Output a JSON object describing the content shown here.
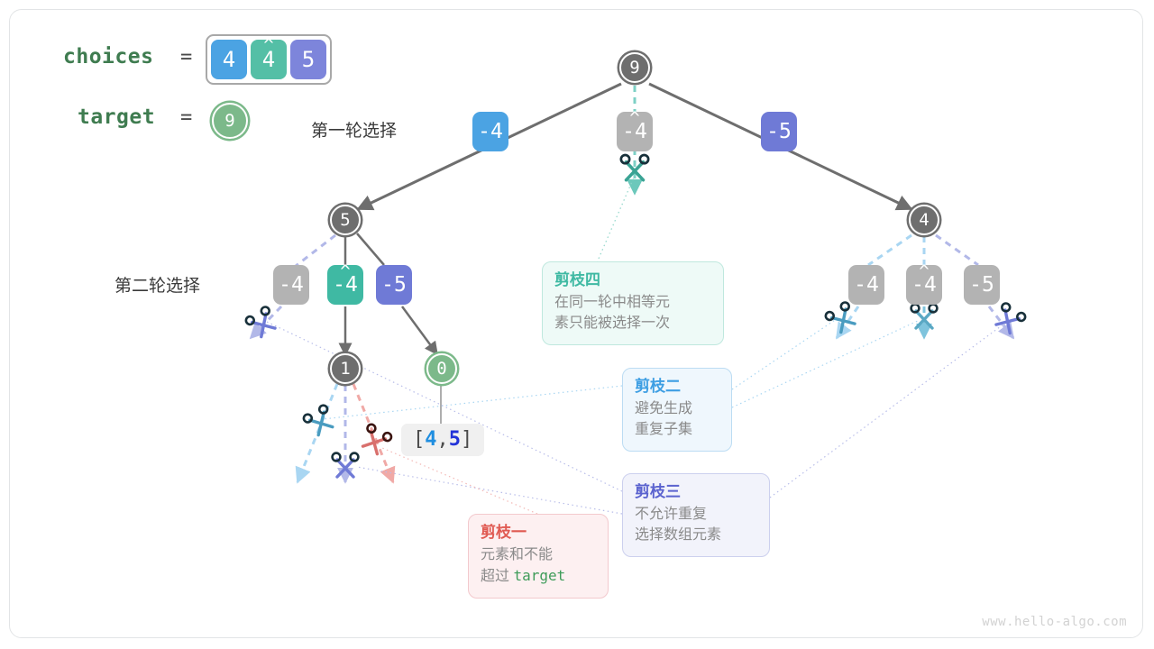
{
  "header": {
    "choices_label": "choices",
    "equals": "=",
    "choices": [
      {
        "value": "4",
        "hat": false,
        "color": "#4ba3e3"
      },
      {
        "value": "4",
        "hat": true,
        "color": "#54bfa6"
      },
      {
        "value": "5",
        "hat": false,
        "color": "#7d85db"
      }
    ],
    "target_label": "target",
    "target_value": "9"
  },
  "round_labels": {
    "first": "第一轮选择",
    "second": "第二轮选择"
  },
  "nodes": {
    "root": "9",
    "left": "5",
    "right": "4",
    "left_child": "1",
    "leaf": "0"
  },
  "edges": {
    "root": [
      {
        "text": "-4",
        "hat": false,
        "style": "blue"
      },
      {
        "text": "-4",
        "hat": true,
        "style": "gray"
      },
      {
        "text": "-5",
        "hat": false,
        "style": "purple"
      }
    ],
    "left": [
      {
        "text": "-4",
        "hat": false,
        "style": "gray"
      },
      {
        "text": "-4",
        "hat": true,
        "style": "teal"
      },
      {
        "text": "-5",
        "hat": false,
        "style": "purple"
      }
    ],
    "right": [
      {
        "text": "-4",
        "hat": false,
        "style": "gray"
      },
      {
        "text": "-4",
        "hat": true,
        "style": "gray"
      },
      {
        "text": "-5",
        "hat": false,
        "style": "gray"
      }
    ]
  },
  "result": {
    "open": "[",
    "v1": "4",
    "comma": ",",
    "v2": "5",
    "close": "]"
  },
  "cards": [
    {
      "id": "pruning-four",
      "title": "剪枝四",
      "line1": "在同一轮中相等元",
      "line2": "素只能被选择一次",
      "color": "#3fb9a3"
    },
    {
      "id": "pruning-two",
      "title": "剪枝二",
      "line1": "避免生成",
      "line2": "重复子集",
      "color": "#3d9ee3"
    },
    {
      "id": "pruning-three",
      "title": "剪枝三",
      "line1": "不允许重复",
      "line2": "选择数组元素",
      "color": "#5b63cf"
    },
    {
      "id": "pruning-one",
      "title": "剪枝一",
      "line1": "元素和不能",
      "line2_pre": "超过 ",
      "line2_code": "target",
      "color": "#e05a52"
    }
  ],
  "watermark": "www.hello-algo.com"
}
